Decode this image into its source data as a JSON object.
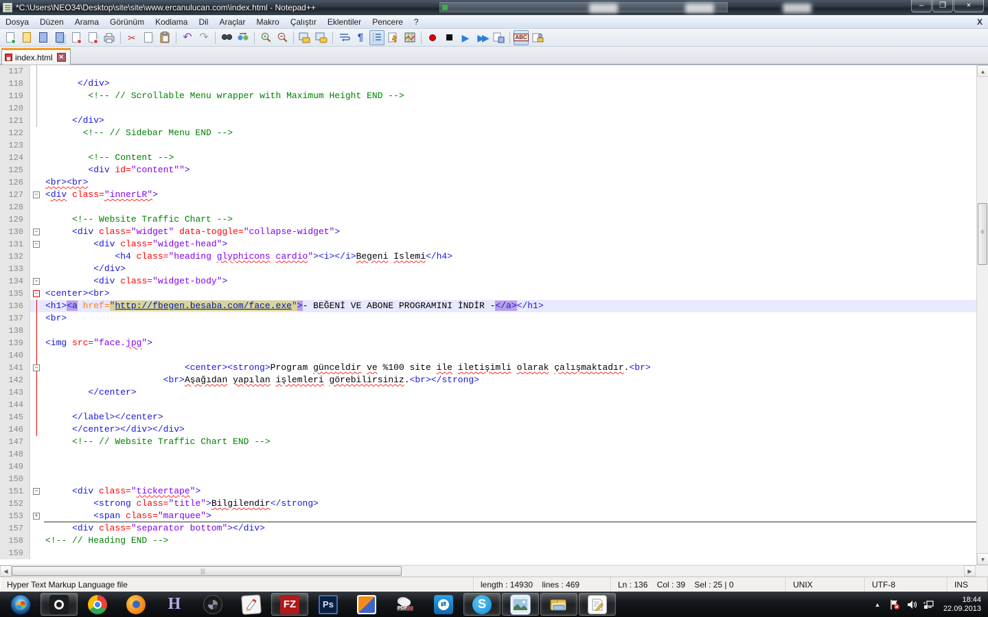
{
  "window": {
    "title": "*C:\\Users\\NEO34\\Desktop\\site\\site\\www.ercanulucan.com\\index.html - Notepad++",
    "controls": {
      "minimize": "–",
      "restore": "❐",
      "close": "×"
    }
  },
  "menu": {
    "items": [
      "Dosya",
      "Düzen",
      "Arama",
      "Görünüm",
      "Kodlama",
      "Dil",
      "Araçlar",
      "Makro",
      "Çalıştır",
      "Eklentiler",
      "Pencere",
      "?"
    ],
    "close_doc": "X"
  },
  "toolbar": {
    "icons": [
      {
        "name": "new-file"
      },
      {
        "name": "open"
      },
      {
        "name": "save"
      },
      {
        "name": "save-all"
      },
      {
        "name": "close"
      },
      {
        "name": "close-all"
      },
      {
        "name": "print"
      },
      {
        "sep": true
      },
      {
        "name": "cut"
      },
      {
        "name": "copy"
      },
      {
        "name": "paste"
      },
      {
        "sep": true
      },
      {
        "name": "undo"
      },
      {
        "name": "redo"
      },
      {
        "sep": true
      },
      {
        "name": "find"
      },
      {
        "name": "replace"
      },
      {
        "sep": true
      },
      {
        "name": "zoom-in"
      },
      {
        "name": "zoom-out"
      },
      {
        "sep": true
      },
      {
        "name": "sync-vertical"
      },
      {
        "name": "sync-horizontal"
      },
      {
        "sep": true
      },
      {
        "name": "word-wrap"
      },
      {
        "name": "show-all-chars"
      },
      {
        "name": "indent-guide",
        "pressed": true
      },
      {
        "name": "function-completion"
      },
      {
        "name": "document-map"
      },
      {
        "sep": true
      },
      {
        "name": "start-record"
      },
      {
        "name": "stop-record"
      },
      {
        "name": "playback"
      },
      {
        "name": "run-macro-multiple"
      },
      {
        "name": "save-macro"
      },
      {
        "sep": true
      },
      {
        "name": "spell-check",
        "pressed": true
      },
      {
        "name": "spell-settings"
      }
    ]
  },
  "tabbar": {
    "active_tab": "index.html"
  },
  "editor": {
    "lines": [
      {
        "n": "117",
        "i": 0,
        "gl": true,
        "tok": []
      },
      {
        "n": "118",
        "i": 6,
        "gl": true,
        "tok": [
          [
            "t",
            "</div>"
          ]
        ]
      },
      {
        "n": "119",
        "i": 8,
        "gl": true,
        "tok": [
          [
            "c",
            "<!-- // Scrollable Menu wrapper with Maximum Height END -->"
          ]
        ]
      },
      {
        "n": "120",
        "i": 0,
        "gl": true,
        "tok": []
      },
      {
        "n": "121",
        "i": 5,
        "gl": true,
        "tok": [
          [
            "t",
            "</div>"
          ]
        ]
      },
      {
        "n": "122",
        "i": 7,
        "tok": [
          [
            "c",
            "<!-- // Sidebar Menu END -->"
          ]
        ]
      },
      {
        "n": "123",
        "i": 0,
        "tok": []
      },
      {
        "n": "124",
        "i": 8,
        "tok": [
          [
            "c",
            "<!-- Content -->"
          ]
        ]
      },
      {
        "n": "125",
        "i": 8,
        "tok": [
          [
            "t",
            "<div "
          ],
          [
            "a",
            "id"
          ],
          [
            "a",
            "="
          ],
          [
            "v",
            "\"content\"\""
          ],
          [
            "t",
            ">"
          ]
        ]
      },
      {
        "n": "126",
        "i": 0,
        "tok": [
          [
            "t w",
            "<br><br>"
          ]
        ]
      },
      {
        "n": "127",
        "i": 0,
        "f": "-",
        "tok": [
          [
            "t",
            "<"
          ],
          [
            "t w",
            "div"
          ],
          [
            "t",
            " "
          ],
          [
            "a",
            "class"
          ],
          [
            "a",
            "="
          ],
          [
            "v w",
            "\"innerLR\""
          ],
          [
            "t",
            ">"
          ]
        ]
      },
      {
        "n": "128",
        "i": 0,
        "tok": []
      },
      {
        "n": "129",
        "i": 5,
        "tok": [
          [
            "c",
            "<!-- Website Traffic Chart -->"
          ]
        ]
      },
      {
        "n": "130",
        "i": 5,
        "f": "-",
        "tok": [
          [
            "t",
            "<div "
          ],
          [
            "a",
            "class"
          ],
          [
            "a",
            "="
          ],
          [
            "v",
            "\"widget\""
          ],
          [
            "t",
            " "
          ],
          [
            "a",
            "data-toggle"
          ],
          [
            "a",
            "="
          ],
          [
            "v",
            "\"collapse-widget\""
          ],
          [
            "t",
            ">"
          ]
        ]
      },
      {
        "n": "131",
        "i": 9,
        "f": "-",
        "tok": [
          [
            "t",
            "<div "
          ],
          [
            "a",
            "class"
          ],
          [
            "a",
            "="
          ],
          [
            "v",
            "\"widget-head\""
          ],
          [
            "t",
            ">"
          ]
        ]
      },
      {
        "n": "132",
        "i": 13,
        "tok": [
          [
            "t",
            "<h4 "
          ],
          [
            "a",
            "class"
          ],
          [
            "a",
            "="
          ],
          [
            "v",
            "\"heading "
          ],
          [
            "v w",
            "glyphicons"
          ],
          [
            "v",
            " "
          ],
          [
            "v w",
            "cardio"
          ],
          [
            "v",
            "\""
          ],
          [
            "t",
            "><i></i>"
          ],
          [
            "x w",
            "Begeni"
          ],
          [
            "x",
            " "
          ],
          [
            "x w",
            "Islemi"
          ],
          [
            "t",
            "</h4>"
          ]
        ]
      },
      {
        "n": "133",
        "i": 9,
        "tok": [
          [
            "t",
            "</div>"
          ]
        ]
      },
      {
        "n": "134",
        "i": 9,
        "f": "-",
        "tok": [
          [
            "t",
            "<div "
          ],
          [
            "a",
            "class"
          ],
          [
            "a",
            "="
          ],
          [
            "v",
            "\"widget-body\""
          ],
          [
            "t",
            ">"
          ]
        ]
      },
      {
        "n": "135",
        "i": 0,
        "f": "-r",
        "tok": [
          [
            "t",
            "<center><br>"
          ]
        ]
      },
      {
        "n": "136",
        "i": 0,
        "rl": true,
        "cur": true,
        "tok": [
          [
            "t",
            "<h1>"
          ],
          [
            "t hv",
            "<a"
          ],
          [
            "x",
            " "
          ],
          [
            "o",
            "href"
          ],
          [
            "o",
            "="
          ],
          [
            "v hk",
            "\""
          ],
          [
            "u hk",
            "http://fbegen.besaba.com/face.exe"
          ],
          [
            "v hk",
            "\""
          ],
          [
            "t hv",
            ">"
          ],
          [
            "x",
            "- BEĞENİ VE ABONE PROGRAMINI İNDİR -"
          ],
          [
            "t hv",
            "</a>"
          ],
          [
            "t",
            "</h1>"
          ]
        ]
      },
      {
        "n": "137",
        "i": 0,
        "rl": true,
        "tok": [
          [
            "t",
            "<br>"
          ]
        ]
      },
      {
        "n": "138",
        "i": 0,
        "rl": true,
        "tok": []
      },
      {
        "n": "139",
        "i": 0,
        "rl": true,
        "tok": [
          [
            "t",
            "<img "
          ],
          [
            "a",
            "src"
          ],
          [
            "a",
            "="
          ],
          [
            "v",
            "\"face."
          ],
          [
            "v w",
            "jpg"
          ],
          [
            "v",
            "\""
          ],
          [
            "t",
            ">"
          ]
        ]
      },
      {
        "n": "140",
        "i": 0,
        "rl": true,
        "tok": []
      },
      {
        "n": "141",
        "i": 26,
        "f": "-",
        "rl": true,
        "tok": [
          [
            "t",
            "<center><strong>"
          ],
          [
            "x",
            "Program "
          ],
          [
            "x w",
            "günceldir"
          ],
          [
            "x",
            " "
          ],
          [
            "x w",
            "ve"
          ],
          [
            "x",
            " %100 site "
          ],
          [
            "x w",
            "ile"
          ],
          [
            "x",
            " "
          ],
          [
            "x w",
            "iletişimli"
          ],
          [
            "x",
            " "
          ],
          [
            "x w",
            "olarak"
          ],
          [
            "x",
            " "
          ],
          [
            "x w",
            "çalışmaktadır"
          ],
          [
            "x",
            "."
          ],
          [
            "t",
            "<br>"
          ]
        ]
      },
      {
        "n": "142",
        "i": 22,
        "rl": true,
        "tok": [
          [
            "t",
            "<br>"
          ],
          [
            "x w",
            "Aşağıdan"
          ],
          [
            "x",
            " "
          ],
          [
            "x w",
            "yapılan"
          ],
          [
            "x",
            " "
          ],
          [
            "x w",
            "işlemleri"
          ],
          [
            "x",
            " "
          ],
          [
            "x w",
            "görebilirsiniz"
          ],
          [
            "x",
            "."
          ],
          [
            "t",
            "<br></strong>"
          ]
        ]
      },
      {
        "n": "143",
        "i": 8,
        "rl": true,
        "tok": [
          [
            "t",
            "</center>"
          ]
        ]
      },
      {
        "n": "144",
        "i": 0,
        "rl": true,
        "tok": []
      },
      {
        "n": "145",
        "i": 5,
        "rl": true,
        "tok": [
          [
            "t",
            "</label></center>"
          ]
        ]
      },
      {
        "n": "146",
        "i": 5,
        "rl": true,
        "tok": [
          [
            "t",
            "</center></div></div>"
          ]
        ]
      },
      {
        "n": "147",
        "i": 5,
        "tok": [
          [
            "c",
            "<!-- // Website Traffic Chart END -->"
          ]
        ]
      },
      {
        "n": "148",
        "i": 0,
        "tok": []
      },
      {
        "n": "149",
        "i": 0,
        "tok": []
      },
      {
        "n": "150",
        "i": 0,
        "tok": []
      },
      {
        "n": "151",
        "i": 5,
        "f": "-",
        "tok": [
          [
            "t",
            "<div "
          ],
          [
            "a",
            "class"
          ],
          [
            "a",
            "="
          ],
          [
            "v",
            "\""
          ],
          [
            "v w",
            "tickertape"
          ],
          [
            "v",
            "\""
          ],
          [
            "t",
            ">"
          ]
        ]
      },
      {
        "n": "152",
        "i": 9,
        "tok": [
          [
            "t",
            "<strong "
          ],
          [
            "a",
            "class"
          ],
          [
            "a",
            "="
          ],
          [
            "v",
            "\"title\""
          ],
          [
            "t",
            ">"
          ],
          [
            "x w",
            "Bilgilendir"
          ],
          [
            "t",
            "</strong>"
          ]
        ]
      },
      {
        "n": "153",
        "i": 9,
        "f": "+",
        "cut": true,
        "tok": [
          [
            "t",
            "<span "
          ],
          [
            "a",
            "class"
          ],
          [
            "a",
            "="
          ],
          [
            "v",
            "\"marquee\""
          ],
          [
            "t",
            ">"
          ]
        ]
      },
      {
        "n": "157",
        "i": 5,
        "tok": [
          [
            "t",
            "<div "
          ],
          [
            "a",
            "class"
          ],
          [
            "a",
            "="
          ],
          [
            "v",
            "\"separator bottom\""
          ],
          [
            "t",
            "></div>"
          ]
        ]
      },
      {
        "n": "158",
        "i": 0,
        "tok": [
          [
            "c",
            "<!-- // Heading END -->"
          ]
        ]
      },
      {
        "n": "159",
        "i": 0,
        "tok": []
      }
    ]
  },
  "statusbar": {
    "doctype": "Hyper Text Markup Language file",
    "length_lines": "length : 14930    lines : 469",
    "cursor": "Ln : 136    Col : 39    Sel : 25 | 0",
    "eol": "UNIX",
    "encoding": "UTF-8",
    "mode": "INS"
  },
  "taskbar": {
    "items": [
      {
        "name": "opera",
        "open": true
      },
      {
        "name": "chrome",
        "open": false
      },
      {
        "name": "firefox",
        "open": false
      },
      {
        "name": "h-app",
        "open": false
      },
      {
        "name": "picasa",
        "open": false
      },
      {
        "name": "paint",
        "open": false
      },
      {
        "name": "filezilla",
        "open": true
      },
      {
        "name": "photoshop",
        "open": false
      },
      {
        "name": "vmware",
        "open": false
      },
      {
        "name": "pdf24",
        "open": false
      },
      {
        "name": "teamviewer",
        "open": false
      },
      {
        "name": "skype",
        "open": true
      },
      {
        "name": "photo-viewer",
        "open": true
      },
      {
        "name": "explorer",
        "open": true
      },
      {
        "name": "notepadpp",
        "open": true
      }
    ],
    "tray": {
      "time": "18:44",
      "date": "22.09.2013"
    }
  },
  "colors": {
    "tag": "#1717d6",
    "attribute": "#ff0000",
    "href_attribute": "#ff8000",
    "value": "#8000f0",
    "comment": "#008000",
    "text": "#000000",
    "current_line": "#e8e8ff",
    "tag_match": "#b9a0e8",
    "selection": "#d8d494",
    "tab_accent": "#f59a20",
    "fold_active": "#e00000"
  }
}
